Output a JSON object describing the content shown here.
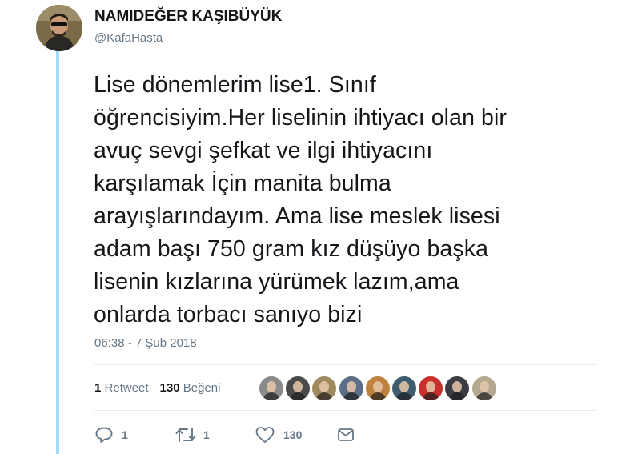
{
  "user": {
    "display_name": "NAMIDEĞER KAŞIBÜYÜK",
    "handle": "@KafaHasta"
  },
  "tweet": {
    "text": "Lise dönemlerim lise1. Sınıf\nöğrencisiyim.Her liselinin ihtiyacı olan bir\navuç sevgi şefkat ve ilgi ihtiyacını\nkarşılamak İçin manita bulma\narayışlarındayım. Ama lise meslek lisesi\nadam başı 750 gram kız düşüyo başka\nlisenin kızlarına yürümek lazım,ama\nonlarda torbacı sanıyo bizi",
    "timestamp": "06:38 - 7 Şub 2018"
  },
  "stats": {
    "retweet_count": "1",
    "retweet_label": "Retweet",
    "like_count": "130",
    "like_label": "Beğeni"
  },
  "liker_avatars": [
    {
      "name": "liker-1",
      "color": "#8a8a8a"
    },
    {
      "name": "liker-2",
      "color": "#4a4a4a"
    },
    {
      "name": "liker-3",
      "color": "#a08a60"
    },
    {
      "name": "liker-4",
      "color": "#5c6f86"
    },
    {
      "name": "liker-5",
      "color": "#c08040"
    },
    {
      "name": "liker-6",
      "color": "#3d5c6e"
    },
    {
      "name": "liker-7",
      "color": "#c8302c"
    },
    {
      "name": "liker-8",
      "color": "#3c3c44"
    },
    {
      "name": "liker-9",
      "color": "#b5a890"
    }
  ],
  "actions": {
    "reply_count": "1",
    "retweet_count": "1",
    "like_count": "130"
  },
  "colors": {
    "thread_line": "#a9daf8",
    "secondary_text": "#657786",
    "primary_text": "#14171a"
  },
  "icons": [
    "reply-icon",
    "retweet-icon",
    "heart-icon",
    "direct-message-icon"
  ]
}
